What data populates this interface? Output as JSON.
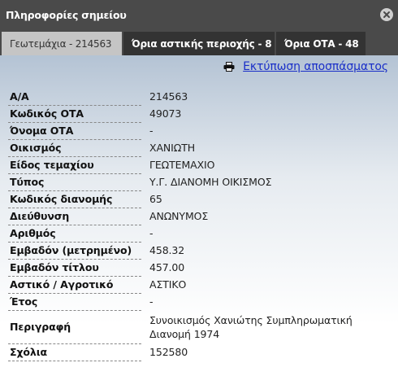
{
  "window": {
    "title": "Πληροφορίες σημείου",
    "close_icon": "close-icon"
  },
  "tabs": [
    {
      "label": "Γεωτεμάχια - 214563",
      "active": true
    },
    {
      "label": "Όρια αστικής περιοχής - 8",
      "active": false
    },
    {
      "label": "Όρια ΟΤΑ - 48",
      "active": false
    }
  ],
  "print": {
    "icon": "printer-icon",
    "label": "Εκτύπωση αποσπάσματος"
  },
  "attributes": [
    {
      "key": "Α/Α",
      "value": "214563"
    },
    {
      "key": "Κωδικός ΟΤΑ",
      "value": "49073"
    },
    {
      "key": "Όνομα ΟΤΑ",
      "value": "-"
    },
    {
      "key": "Οικισμός",
      "value": "ΧΑΝΙΩΤΗ"
    },
    {
      "key": "Είδος τεμαχίου",
      "value": "ΓΕΩΤΕΜΑΧΙΟ"
    },
    {
      "key": "Τύπος",
      "value": "Υ.Γ. ΔΙΑΝΟΜΗ ΟΙΚΙΣΜΟΣ"
    },
    {
      "key": "Κωδικός διανομής",
      "value": "65"
    },
    {
      "key": "Διεύθυνση",
      "value": "ΑΝΩΝΥΜΟΣ"
    },
    {
      "key": "Αριθμός",
      "value": "-"
    },
    {
      "key": "Εμβαδόν (μετρημένο)",
      "value": "458.32"
    },
    {
      "key": "Εμβαδόν τίτλου",
      "value": "457.00"
    },
    {
      "key": "Αστικό / Αγροτικό",
      "value": "ΑΣΤΙΚΟ"
    },
    {
      "key": "Έτος",
      "value": "-"
    },
    {
      "key": "Περιγραφή",
      "value": "Συνοικισμός Χανιώτης Συμπληρωματική Διανομή 1974"
    },
    {
      "key": "Σχόλια",
      "value": "152580"
    }
  ],
  "colors": {
    "titlebar": "#4a4a4a",
    "active_tab": "#c5c5c5",
    "link": "#1a2fc8"
  }
}
